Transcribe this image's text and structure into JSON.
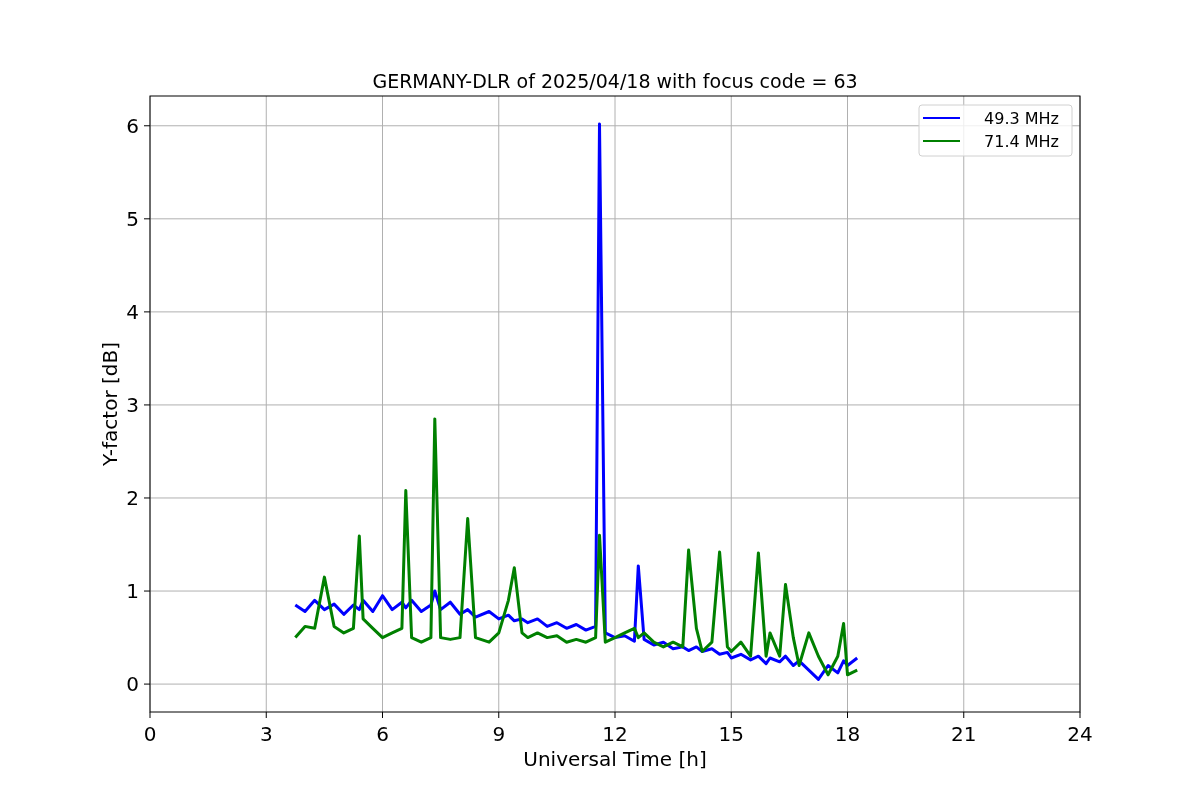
{
  "chart_data": {
    "type": "line",
    "title": "GERMANY-DLR of 2025/04/18 with focus code = 63",
    "xlabel": "Universal Time [h]",
    "ylabel": "Y-factor [dB]",
    "x": [
      3.75,
      4,
      4.25,
      4.5,
      4.75,
      5,
      5.25,
      5.4,
      5.5,
      5.75,
      6,
      6.25,
      6.5,
      6.6,
      6.75,
      7,
      7.25,
      7.35,
      7.5,
      7.75,
      8,
      8.2,
      8.4,
      8.75,
      9,
      9.25,
      9.4,
      9.6,
      9.75,
      10,
      10.25,
      10.5,
      10.75,
      11,
      11.25,
      11.5,
      11.6,
      11.75,
      12,
      12.25,
      12.5,
      12.6,
      12.75,
      13,
      13.25,
      13.5,
      13.75,
      13.9,
      14.1,
      14.25,
      14.5,
      14.7,
      14.9,
      15,
      15.25,
      15.5,
      15.7,
      15.9,
      16,
      16.25,
      16.4,
      16.6,
      16.75,
      17,
      17.25,
      17.5,
      17.75,
      17.9,
      18,
      18.25
    ],
    "series": [
      {
        "name": "49.3 MHz",
        "color": "#0000ff",
        "values": [
          0.85,
          0.78,
          0.9,
          0.8,
          0.86,
          0.75,
          0.85,
          0.8,
          0.9,
          0.78,
          0.95,
          0.8,
          0.88,
          0.82,
          0.9,
          0.78,
          0.85,
          1.0,
          0.8,
          0.88,
          0.75,
          0.8,
          0.72,
          0.78,
          0.7,
          0.74,
          0.68,
          0.7,
          0.66,
          0.7,
          0.62,
          0.66,
          0.6,
          0.64,
          0.58,
          0.62,
          6.02,
          0.55,
          0.5,
          0.52,
          0.46,
          1.27,
          0.48,
          0.42,
          0.45,
          0.38,
          0.4,
          0.36,
          0.4,
          0.35,
          0.38,
          0.32,
          0.34,
          0.28,
          0.32,
          0.26,
          0.3,
          0.22,
          0.28,
          0.24,
          0.3,
          0.2,
          0.25,
          0.15,
          0.05,
          0.2,
          0.12,
          0.25,
          0.2,
          0.28
        ]
      },
      {
        "name": "71.4 MHz",
        "color": "#008000",
        "values": [
          0.5,
          0.62,
          0.6,
          1.15,
          0.62,
          0.55,
          0.6,
          1.59,
          0.7,
          0.6,
          0.5,
          0.55,
          0.6,
          2.08,
          0.5,
          0.45,
          0.5,
          2.85,
          0.5,
          0.48,
          0.5,
          1.78,
          0.5,
          0.45,
          0.55,
          0.9,
          1.25,
          0.55,
          0.5,
          0.55,
          0.5,
          0.52,
          0.45,
          0.48,
          0.45,
          0.5,
          1.6,
          0.45,
          0.5,
          0.55,
          0.6,
          0.5,
          0.55,
          0.45,
          0.4,
          0.45,
          0.4,
          1.44,
          0.6,
          0.35,
          0.45,
          1.42,
          0.4,
          0.35,
          0.45,
          0.3,
          1.41,
          0.3,
          0.55,
          0.3,
          1.07,
          0.5,
          0.2,
          0.55,
          0.3,
          0.1,
          0.3,
          0.65,
          0.1,
          0.15
        ]
      }
    ],
    "grid": true,
    "legend": true,
    "xlim": [
      0,
      24
    ],
    "ylim": [
      -0.3,
      6.32
    ],
    "xticks": [
      0,
      3,
      6,
      9,
      12,
      15,
      18,
      21,
      24
    ],
    "yticks": [
      0,
      1,
      2,
      3,
      4,
      5,
      6
    ]
  }
}
